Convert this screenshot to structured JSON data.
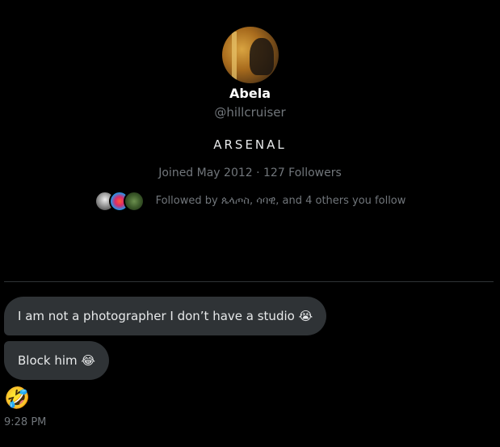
{
  "profile": {
    "name": "Abela",
    "handle": "@hillcruiser",
    "bio": "ARSENAL",
    "meta": "Joined May 2012 · 127 Followers",
    "followed_by": "Followed by ጴላጦስ, ሳባዊ, and 4 others you follow"
  },
  "messages": [
    {
      "text": "I am not a photographer I don’t have a studio 😭"
    },
    {
      "text": "Block him 😂"
    },
    {
      "text": "🤣"
    }
  ],
  "timestamp": "9:28 PM",
  "colors": {
    "background": "#000000",
    "bubble": "#2f3336",
    "muted": "#71767b",
    "text": "#e7e9ea"
  }
}
